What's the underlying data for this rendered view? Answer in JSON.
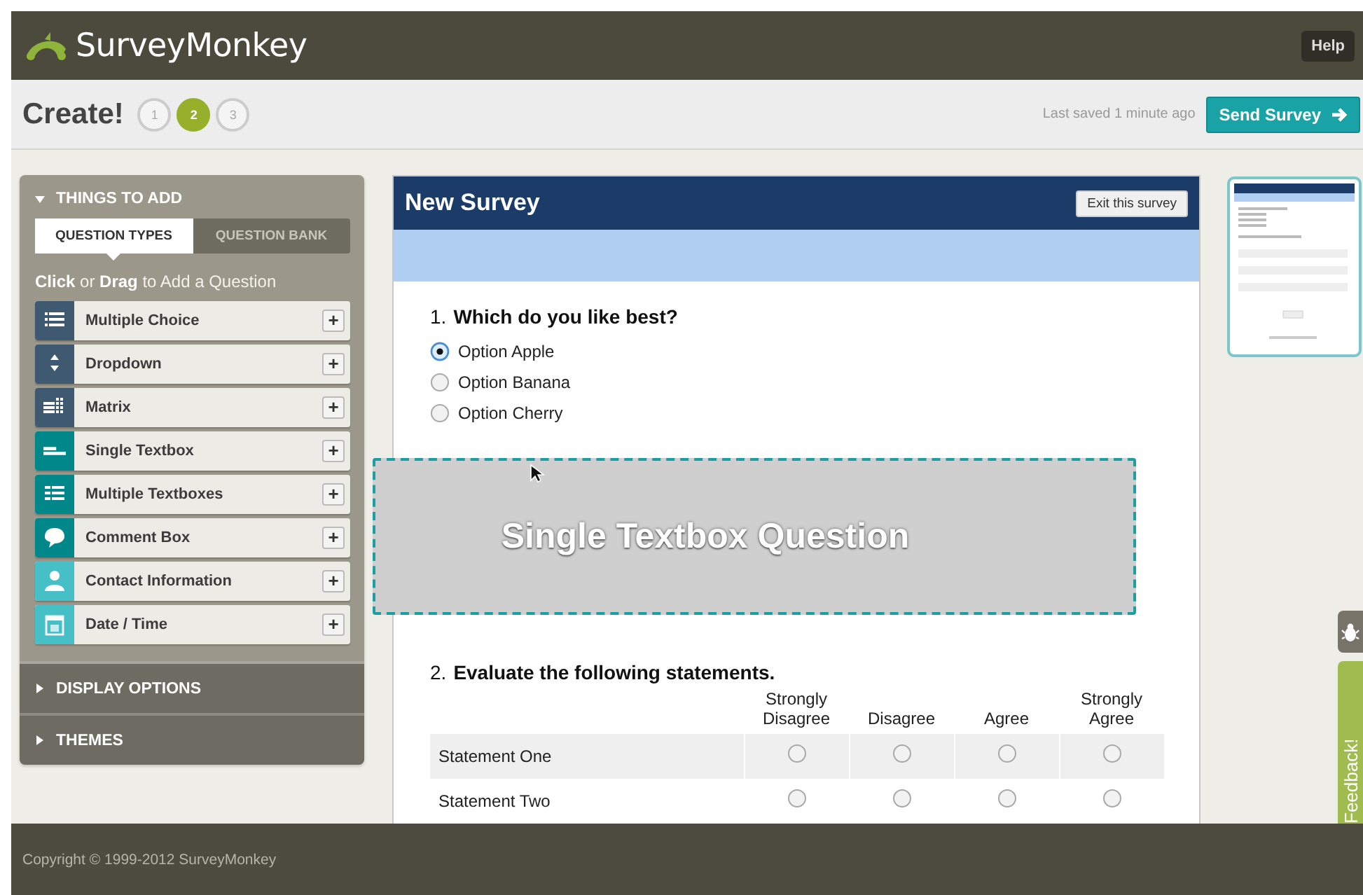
{
  "header": {
    "logo": "SurveyMonkey",
    "help": "Help"
  },
  "toolbar": {
    "title": "Create!",
    "steps": [
      {
        "label": "1",
        "selected": false
      },
      {
        "label": "2",
        "selected": true
      },
      {
        "label": "3",
        "selected": false
      }
    ],
    "last_saved": "Last saved 1 minute ago",
    "send_button": "Send Survey"
  },
  "sidebar": {
    "panel": {
      "title": "THINGS TO ADD",
      "expanded": true,
      "tabs": [
        {
          "label": "QUESTION TYPES",
          "selected": true
        },
        {
          "label": "QUESTION BANK",
          "selected": false
        }
      ],
      "instruction": "**Click** or **Drag** to Add a Question",
      "items": [
        {
          "label": "Multiple Choice",
          "kind": "list",
          "color": "#3f5a70",
          "add": "+"
        },
        {
          "label": "Dropdown",
          "kind": "dropdown",
          "color": "#3f5a70",
          "add": "+"
        },
        {
          "label": "Matrix",
          "kind": "matrix",
          "color": "#3f5a70",
          "add": "+"
        },
        {
          "label": "Single Textbox",
          "kind": "textbox",
          "color": "#00878a",
          "add": "+"
        },
        {
          "label": "Multiple Textboxes",
          "kind": "textboxes",
          "color": "#00878a",
          "add": "+"
        },
        {
          "label": "Comment Box",
          "kind": "comment",
          "color": "#00878a",
          "add": "+"
        },
        {
          "label": "Contact Information",
          "kind": "contact",
          "color": "#47bfc6",
          "add": "+"
        },
        {
          "label": "Date / Time",
          "kind": "date",
          "color": "#47bfc6",
          "add": "+"
        }
      ]
    },
    "sections": [
      {
        "title": "DISPLAY OPTIONS",
        "expanded": false
      },
      {
        "title": "THEMES",
        "expanded": false
      }
    ]
  },
  "survey": {
    "title": "New Survey",
    "exit_button": "Exit this survey",
    "items": [
      {
        "kind": "choice",
        "number": "1.",
        "text": "Which do you like best?",
        "options": [
          {
            "label": "Option Apple",
            "selected": true
          },
          {
            "label": "Option Banana",
            "selected": false
          },
          {
            "label": "Option Cherry",
            "selected": false
          }
        ]
      },
      {
        "kind": "drop_zone",
        "text": "Single Textbox Question"
      },
      {
        "kind": "matrix",
        "number": "2.",
        "text": "Evaluate the following statements.",
        "columns": [
          "Strongly Disagree",
          "Disagree",
          "Agree",
          "Strongly Agree"
        ],
        "rows": [
          {
            "label": "Statement One",
            "choices": [
              {
                "selected": false
              },
              {
                "selected": false
              },
              {
                "selected": false
              },
              {
                "selected": false
              }
            ]
          },
          {
            "label": "Statement Two",
            "choices": [
              {
                "selected": false
              },
              {
                "selected": false
              },
              {
                "selected": false
              },
              {
                "selected": false
              }
            ]
          }
        ]
      }
    ]
  },
  "feedback_tab": "Feedback!",
  "footer": {
    "copyright": "Copyright © 1999-2012 SurveyMonkey"
  }
}
